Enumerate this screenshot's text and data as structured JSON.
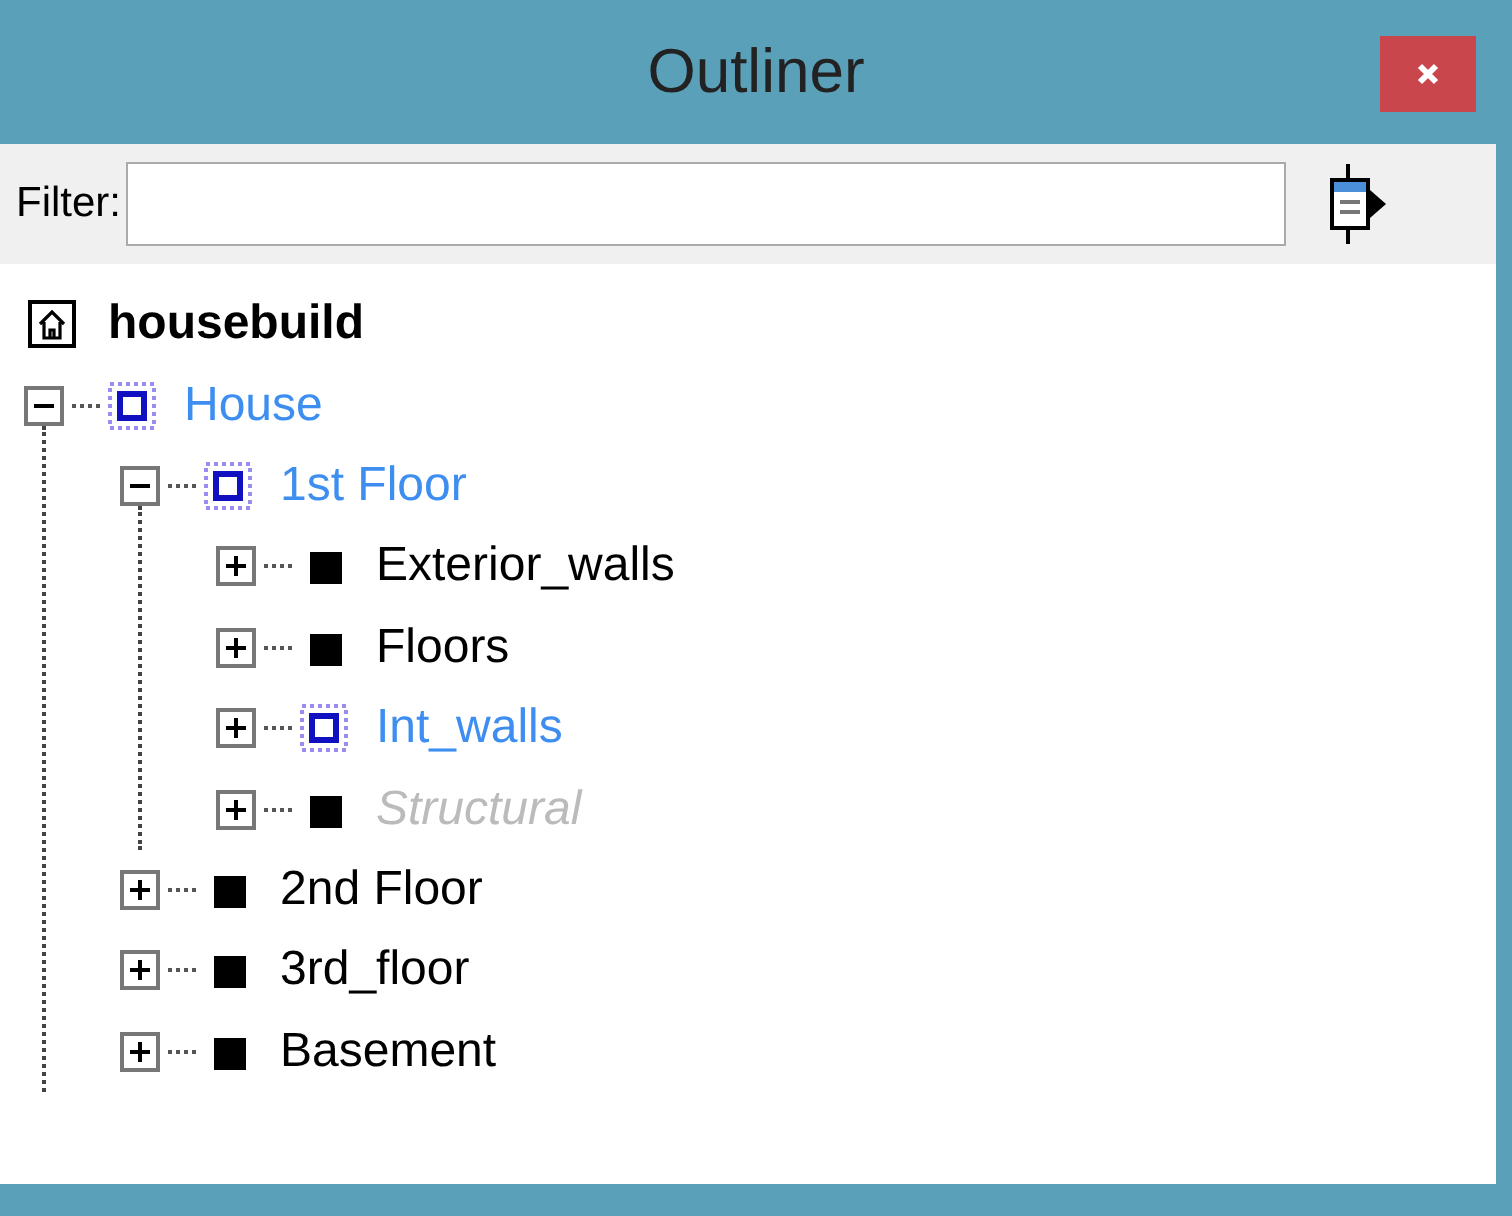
{
  "window": {
    "title": "Outliner"
  },
  "filter": {
    "label": "Filter:"
  },
  "tree": {
    "label": "housebuild",
    "children": [
      {
        "label": "House",
        "in_context": true,
        "hidden": false,
        "expanded": true,
        "children": [
          {
            "label": "1st Floor",
            "in_context": true,
            "hidden": false,
            "expanded": true,
            "children": [
              {
                "label": "Exterior_walls",
                "in_context": false,
                "hidden": false,
                "expanded": false
              },
              {
                "label": "Floors",
                "in_context": false,
                "hidden": false,
                "expanded": false
              },
              {
                "label": "Int_walls",
                "in_context": true,
                "hidden": false,
                "expanded": false
              },
              {
                "label": "Structural",
                "in_context": false,
                "hidden": true,
                "expanded": false
              }
            ]
          },
          {
            "label": "2nd Floor",
            "in_context": false,
            "hidden": false,
            "expanded": false
          },
          {
            "label": "3rd_floor",
            "in_context": false,
            "hidden": false,
            "expanded": false
          },
          {
            "label": "Basement",
            "in_context": false,
            "hidden": false,
            "expanded": false
          }
        ]
      }
    ]
  }
}
